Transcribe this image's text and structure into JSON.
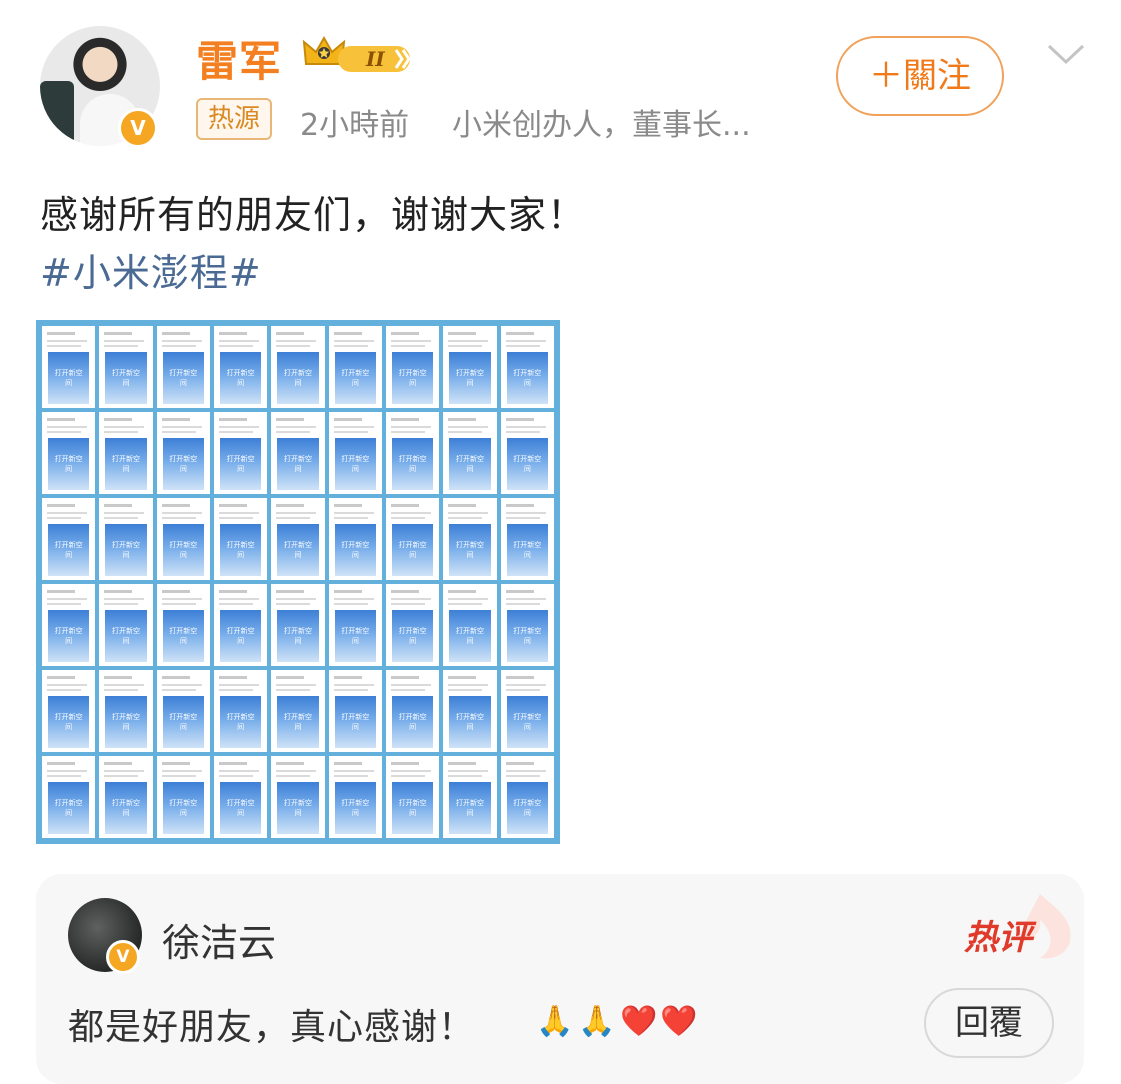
{
  "post": {
    "author": {
      "name": "雷军",
      "level_badge": "II",
      "tag": "热源",
      "time": "2小時前",
      "description": "小米创办人，董事长..."
    },
    "follow_label": "＋關注",
    "text": "感谢所有的朋友们，谢谢大家！",
    "hashtag": "#小米澎程#",
    "image_tile_caption": "打开新空间",
    "image_grid": {
      "rows": 6,
      "cols": 9
    }
  },
  "hot_comment": {
    "badge": "热评",
    "author": "徐洁云",
    "text": "都是好朋友，真心感谢！",
    "emojis": [
      "🙏",
      "🙏",
      "❤️",
      "❤️"
    ],
    "reply_label": "回覆"
  },
  "colors": {
    "brand_orange": "#f47f20",
    "hashtag_blue": "#4a6a93",
    "verified_badge": "#f5a623",
    "hot_red": "#e03a2a"
  },
  "icons": {
    "verified": "verified-v-icon",
    "crown": "crown-level-icon",
    "more": "chevron-down-icon"
  }
}
